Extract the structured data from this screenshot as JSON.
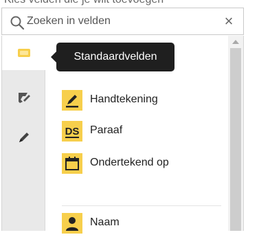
{
  "top_text": "Kies velden die je wilt toevoegen",
  "search": {
    "placeholder": "Zoeken in velden",
    "clear_icon": "close-icon"
  },
  "tooltip": {
    "text": "Standaardvelden"
  },
  "rail": [
    {
      "name": "standard-fields",
      "icon": "rectangle-icon",
      "active": true
    },
    {
      "name": "signature-tools",
      "icon": "tool-icon",
      "active": false
    },
    {
      "name": "edit-tools",
      "icon": "pen-icon",
      "active": false
    }
  ],
  "fields": [
    {
      "label": "Handtekening",
      "icon": "signature-pen-icon"
    },
    {
      "label": "Paraaf",
      "icon": "initials-ds-icon",
      "icon_text": "DS"
    },
    {
      "label": "Ondertekend op",
      "icon": "calendar-icon"
    },
    {
      "label": "Naam",
      "icon": "person-icon"
    }
  ],
  "colors": {
    "accent": "#f7cf4c",
    "tooltip_bg": "#1f1f1f",
    "rail_bg": "#e9e9e9"
  }
}
